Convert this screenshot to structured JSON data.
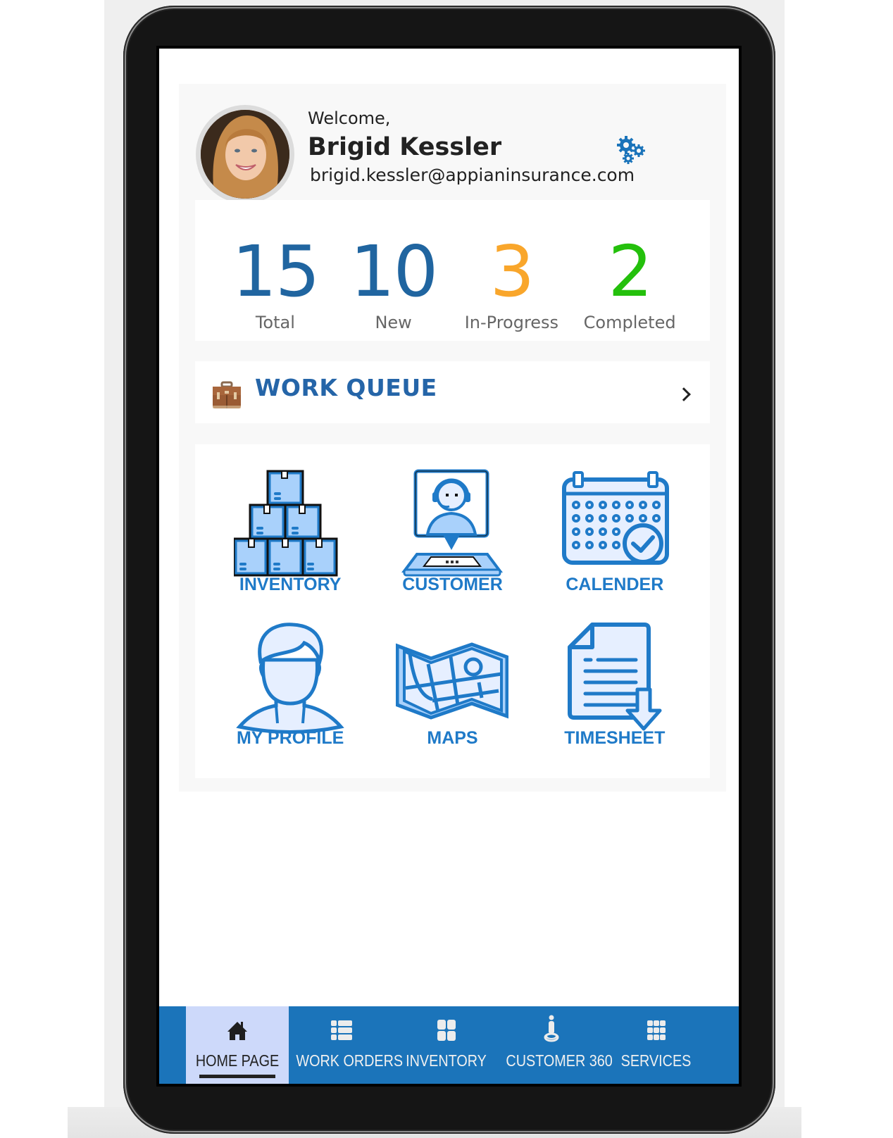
{
  "header": {
    "welcome": "Welcome,",
    "user_name": "Brigid Kessler",
    "user_email": "brigid.kessler@appianinsurance.com",
    "settings_icon": "gears-icon"
  },
  "stats": [
    {
      "value": "15",
      "label": "Total",
      "color": "#2065a0"
    },
    {
      "value": "10",
      "label": "New",
      "color": "#2065a0"
    },
    {
      "value": "3",
      "label": "In-Progress",
      "color": "#f9a62b"
    },
    {
      "value": "2",
      "label": "Completed",
      "color": "#24c00c"
    }
  ],
  "work_queue": {
    "icon": "briefcase-icon",
    "title": "WORK QUEUE"
  },
  "tiles": [
    {
      "label": "INVENTORY",
      "icon": "boxes-icon"
    },
    {
      "label": "CUSTOMER",
      "icon": "customer-support-icon"
    },
    {
      "label": "CALENDER",
      "icon": "calendar-check-icon"
    },
    {
      "label": "MY PROFILE",
      "icon": "user-profile-icon"
    },
    {
      "label": "MAPS",
      "icon": "map-icon"
    },
    {
      "label": "TIMESHEET",
      "icon": "document-download-icon"
    }
  ],
  "nav": {
    "active": "HOME PAGE",
    "items": [
      {
        "label": "HOME PAGE",
        "icon": "home-icon"
      },
      {
        "label": "WORK ORDERS",
        "icon": "list-icon"
      },
      {
        "label": "INVENTORY",
        "icon": "grid-four-icon"
      },
      {
        "label": "CUSTOMER 360",
        "icon": "person-pin-icon"
      },
      {
        "label": "SERVICES",
        "icon": "apps-grid-icon"
      }
    ]
  },
  "colors": {
    "accent": "#1b74ba",
    "title_blue": "#2565a8",
    "tile_blue": "#1f7ac8",
    "active_tab": "#cdd9fa",
    "in_progress": "#f9a62b",
    "completed": "#24c00c"
  }
}
